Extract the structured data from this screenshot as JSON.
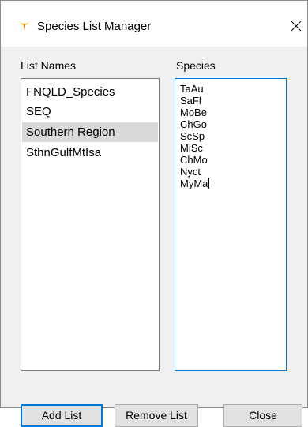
{
  "window": {
    "title": "Species List Manager",
    "icon": "bird-icon",
    "close_icon": "close-icon"
  },
  "list_names": {
    "label": "List Names",
    "items": [
      {
        "label": "FNQLD_Species",
        "selected": false
      },
      {
        "label": "SEQ",
        "selected": false
      },
      {
        "label": "Southern Region",
        "selected": true
      },
      {
        "label": "SthnGulfMtIsa",
        "selected": false
      }
    ]
  },
  "species": {
    "label": "Species",
    "lines": [
      "TaAu",
      "SaFl",
      "MoBe",
      "ChGo",
      "ScSp",
      "MiSc",
      "ChMo",
      "Nyct",
      "MyMa"
    ]
  },
  "buttons": {
    "add_list": "Add List",
    "remove_list": "Remove List",
    "close": "Close"
  },
  "colors": {
    "accent": "#0078d7",
    "icon_yellow": "#f5b800",
    "icon_orange": "#e07a00",
    "selection": "#d9d9d9",
    "client_bg": "#f0f0f0"
  }
}
